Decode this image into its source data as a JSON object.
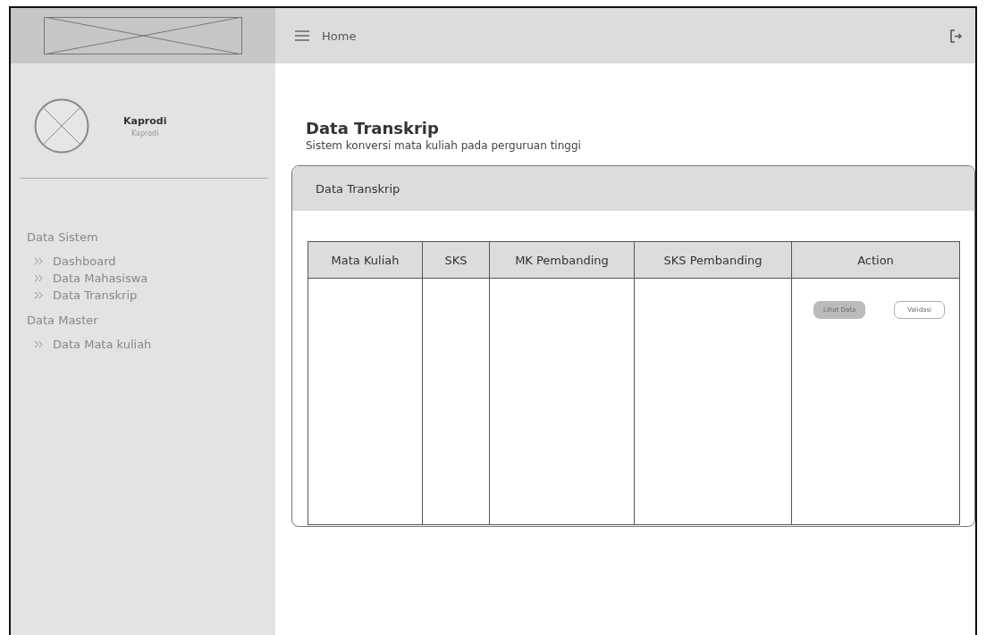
{
  "header": {
    "title": "Home"
  },
  "profile": {
    "name": "Kaprodi",
    "role": "Kaprodi"
  },
  "sidebar": {
    "sections": [
      {
        "title": "Data Sistem",
        "items": [
          {
            "label": "Dashboard"
          },
          {
            "label": "Data Mahasiswa"
          },
          {
            "label": "Data Transkrip"
          }
        ]
      },
      {
        "title": "Data Master",
        "items": [
          {
            "label": "Data Mata kuliah"
          }
        ]
      }
    ]
  },
  "page": {
    "title": "Data Transkrip",
    "subtitle": "Sistem konversi mata kuliah pada perguruan tinggi"
  },
  "card": {
    "title": "Data Transkrip"
  },
  "table": {
    "columns": [
      "Mata Kuliah",
      "SKS",
      "MK Pembanding",
      "SKS Pembanding",
      "Action"
    ],
    "action_buttons": [
      {
        "label": "Lihat Data",
        "kind": "filled"
      },
      {
        "label": "Validasi",
        "kind": "outline"
      }
    ]
  }
}
